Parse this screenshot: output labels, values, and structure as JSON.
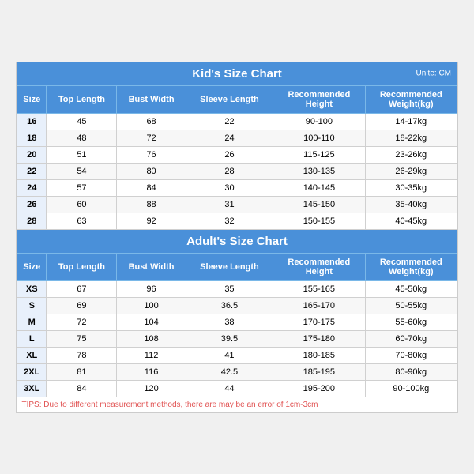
{
  "kids_section": {
    "title": "Kid's Size Chart",
    "unit": "Unite: CM",
    "headers": [
      "Size",
      "Top Length",
      "Bust Width",
      "Sleeve Length",
      "Recommended Height",
      "Recommended Weight(kg)"
    ],
    "rows": [
      [
        "16",
        "45",
        "68",
        "22",
        "90-100",
        "14-17kg"
      ],
      [
        "18",
        "48",
        "72",
        "24",
        "100-110",
        "18-22kg"
      ],
      [
        "20",
        "51",
        "76",
        "26",
        "115-125",
        "23-26kg"
      ],
      [
        "22",
        "54",
        "80",
        "28",
        "130-135",
        "26-29kg"
      ],
      [
        "24",
        "57",
        "84",
        "30",
        "140-145",
        "30-35kg"
      ],
      [
        "26",
        "60",
        "88",
        "31",
        "145-150",
        "35-40kg"
      ],
      [
        "28",
        "63",
        "92",
        "32",
        "150-155",
        "40-45kg"
      ]
    ]
  },
  "adults_section": {
    "title": "Adult's Size Chart",
    "headers": [
      "Size",
      "Top Length",
      "Bust Width",
      "Sleeve Length",
      "Recommended Height",
      "Recommended Weight(kg)"
    ],
    "rows": [
      [
        "XS",
        "67",
        "96",
        "35",
        "155-165",
        "45-50kg"
      ],
      [
        "S",
        "69",
        "100",
        "36.5",
        "165-170",
        "50-55kg"
      ],
      [
        "M",
        "72",
        "104",
        "38",
        "170-175",
        "55-60kg"
      ],
      [
        "L",
        "75",
        "108",
        "39.5",
        "175-180",
        "60-70kg"
      ],
      [
        "XL",
        "78",
        "112",
        "41",
        "180-185",
        "70-80kg"
      ],
      [
        "2XL",
        "81",
        "116",
        "42.5",
        "185-195",
        "80-90kg"
      ],
      [
        "3XL",
        "84",
        "120",
        "44",
        "195-200",
        "90-100kg"
      ]
    ],
    "tips": "TIPS: Due to different measurement methods, there are may be an error of 1cm-3cm"
  }
}
